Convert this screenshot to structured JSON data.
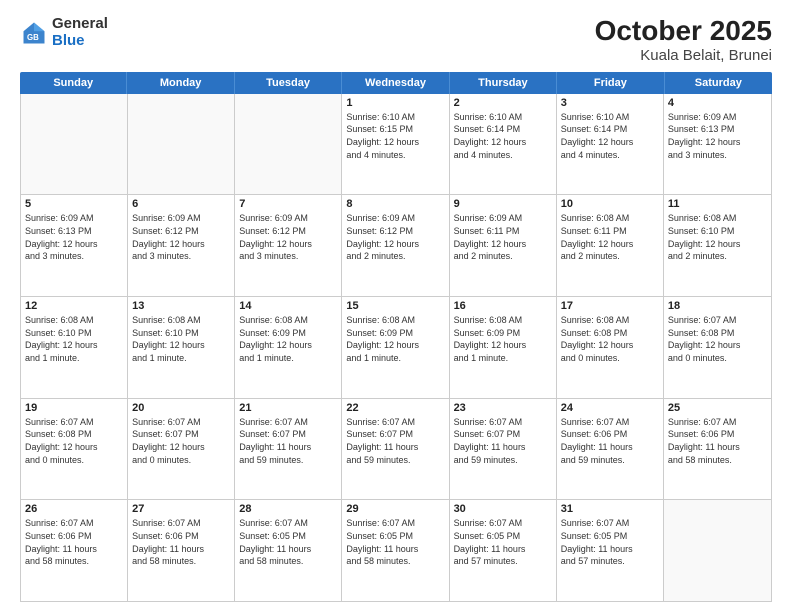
{
  "header": {
    "logo_general": "General",
    "logo_blue": "Blue",
    "title": "October 2025",
    "subtitle": "Kuala Belait, Brunei"
  },
  "days_of_week": [
    "Sunday",
    "Monday",
    "Tuesday",
    "Wednesday",
    "Thursday",
    "Friday",
    "Saturday"
  ],
  "weeks": [
    [
      {
        "day": "",
        "empty": true
      },
      {
        "day": "",
        "empty": true
      },
      {
        "day": "",
        "empty": true
      },
      {
        "day": "1",
        "lines": [
          "Sunrise: 6:10 AM",
          "Sunset: 6:15 PM",
          "Daylight: 12 hours",
          "and 4 minutes."
        ]
      },
      {
        "day": "2",
        "lines": [
          "Sunrise: 6:10 AM",
          "Sunset: 6:14 PM",
          "Daylight: 12 hours",
          "and 4 minutes."
        ]
      },
      {
        "day": "3",
        "lines": [
          "Sunrise: 6:10 AM",
          "Sunset: 6:14 PM",
          "Daylight: 12 hours",
          "and 4 minutes."
        ]
      },
      {
        "day": "4",
        "lines": [
          "Sunrise: 6:09 AM",
          "Sunset: 6:13 PM",
          "Daylight: 12 hours",
          "and 3 minutes."
        ]
      }
    ],
    [
      {
        "day": "5",
        "lines": [
          "Sunrise: 6:09 AM",
          "Sunset: 6:13 PM",
          "Daylight: 12 hours",
          "and 3 minutes."
        ]
      },
      {
        "day": "6",
        "lines": [
          "Sunrise: 6:09 AM",
          "Sunset: 6:12 PM",
          "Daylight: 12 hours",
          "and 3 minutes."
        ]
      },
      {
        "day": "7",
        "lines": [
          "Sunrise: 6:09 AM",
          "Sunset: 6:12 PM",
          "Daylight: 12 hours",
          "and 3 minutes."
        ]
      },
      {
        "day": "8",
        "lines": [
          "Sunrise: 6:09 AM",
          "Sunset: 6:12 PM",
          "Daylight: 12 hours",
          "and 2 minutes."
        ]
      },
      {
        "day": "9",
        "lines": [
          "Sunrise: 6:09 AM",
          "Sunset: 6:11 PM",
          "Daylight: 12 hours",
          "and 2 minutes."
        ]
      },
      {
        "day": "10",
        "lines": [
          "Sunrise: 6:08 AM",
          "Sunset: 6:11 PM",
          "Daylight: 12 hours",
          "and 2 minutes."
        ]
      },
      {
        "day": "11",
        "lines": [
          "Sunrise: 6:08 AM",
          "Sunset: 6:10 PM",
          "Daylight: 12 hours",
          "and 2 minutes."
        ]
      }
    ],
    [
      {
        "day": "12",
        "lines": [
          "Sunrise: 6:08 AM",
          "Sunset: 6:10 PM",
          "Daylight: 12 hours",
          "and 1 minute."
        ]
      },
      {
        "day": "13",
        "lines": [
          "Sunrise: 6:08 AM",
          "Sunset: 6:10 PM",
          "Daylight: 12 hours",
          "and 1 minute."
        ]
      },
      {
        "day": "14",
        "lines": [
          "Sunrise: 6:08 AM",
          "Sunset: 6:09 PM",
          "Daylight: 12 hours",
          "and 1 minute."
        ]
      },
      {
        "day": "15",
        "lines": [
          "Sunrise: 6:08 AM",
          "Sunset: 6:09 PM",
          "Daylight: 12 hours",
          "and 1 minute."
        ]
      },
      {
        "day": "16",
        "lines": [
          "Sunrise: 6:08 AM",
          "Sunset: 6:09 PM",
          "Daylight: 12 hours",
          "and 1 minute."
        ]
      },
      {
        "day": "17",
        "lines": [
          "Sunrise: 6:08 AM",
          "Sunset: 6:08 PM",
          "Daylight: 12 hours",
          "and 0 minutes."
        ]
      },
      {
        "day": "18",
        "lines": [
          "Sunrise: 6:07 AM",
          "Sunset: 6:08 PM",
          "Daylight: 12 hours",
          "and 0 minutes."
        ]
      }
    ],
    [
      {
        "day": "19",
        "lines": [
          "Sunrise: 6:07 AM",
          "Sunset: 6:08 PM",
          "Daylight: 12 hours",
          "and 0 minutes."
        ]
      },
      {
        "day": "20",
        "lines": [
          "Sunrise: 6:07 AM",
          "Sunset: 6:07 PM",
          "Daylight: 12 hours",
          "and 0 minutes."
        ]
      },
      {
        "day": "21",
        "lines": [
          "Sunrise: 6:07 AM",
          "Sunset: 6:07 PM",
          "Daylight: 11 hours",
          "and 59 minutes."
        ]
      },
      {
        "day": "22",
        "lines": [
          "Sunrise: 6:07 AM",
          "Sunset: 6:07 PM",
          "Daylight: 11 hours",
          "and 59 minutes."
        ]
      },
      {
        "day": "23",
        "lines": [
          "Sunrise: 6:07 AM",
          "Sunset: 6:07 PM",
          "Daylight: 11 hours",
          "and 59 minutes."
        ]
      },
      {
        "day": "24",
        "lines": [
          "Sunrise: 6:07 AM",
          "Sunset: 6:06 PM",
          "Daylight: 11 hours",
          "and 59 minutes."
        ]
      },
      {
        "day": "25",
        "lines": [
          "Sunrise: 6:07 AM",
          "Sunset: 6:06 PM",
          "Daylight: 11 hours",
          "and 58 minutes."
        ]
      }
    ],
    [
      {
        "day": "26",
        "lines": [
          "Sunrise: 6:07 AM",
          "Sunset: 6:06 PM",
          "Daylight: 11 hours",
          "and 58 minutes."
        ]
      },
      {
        "day": "27",
        "lines": [
          "Sunrise: 6:07 AM",
          "Sunset: 6:06 PM",
          "Daylight: 11 hours",
          "and 58 minutes."
        ]
      },
      {
        "day": "28",
        "lines": [
          "Sunrise: 6:07 AM",
          "Sunset: 6:05 PM",
          "Daylight: 11 hours",
          "and 58 minutes."
        ]
      },
      {
        "day": "29",
        "lines": [
          "Sunrise: 6:07 AM",
          "Sunset: 6:05 PM",
          "Daylight: 11 hours",
          "and 58 minutes."
        ]
      },
      {
        "day": "30",
        "lines": [
          "Sunrise: 6:07 AM",
          "Sunset: 6:05 PM",
          "Daylight: 11 hours",
          "and 57 minutes."
        ]
      },
      {
        "day": "31",
        "lines": [
          "Sunrise: 6:07 AM",
          "Sunset: 6:05 PM",
          "Daylight: 11 hours",
          "and 57 minutes."
        ]
      },
      {
        "day": "",
        "empty": true
      }
    ]
  ]
}
